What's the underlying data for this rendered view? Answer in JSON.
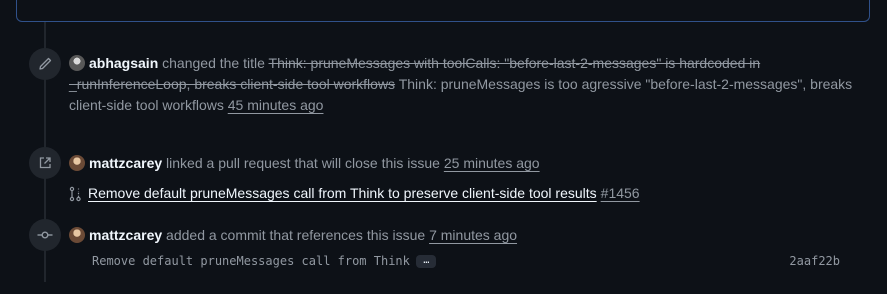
{
  "events": {
    "rename": {
      "actor": "abhagsain",
      "action": "changed the title",
      "old_title": "Think: pruneMessages with toolCalls: \"before-last-2-messages\" is hardcoded in _runInferenceLoop, breaks client-side tool workflows",
      "new_title": "Think: pruneMessages is too agressive \"before-last-2-messages\", breaks client-side tool workflows",
      "time": "45 minutes ago"
    },
    "linked_pr": {
      "actor": "mattzcarey",
      "action": "linked a pull request that will close this issue",
      "time": "25 minutes ago",
      "pr_title": "Remove default pruneMessages call from Think to preserve client-side tool results",
      "pr_number": "#1456"
    },
    "commit": {
      "actor": "mattzcarey",
      "action": "added a commit that references this issue",
      "time": "7 minutes ago",
      "message": "Remove default pruneMessages call from Think",
      "ellipsis": "…",
      "sha": "2aaf22b"
    }
  },
  "icons": {
    "rename": "pencil-icon",
    "cross_reference": "external-link-icon",
    "pr": "git-pull-request-icon",
    "commit": "git-commit-icon"
  },
  "colors": {
    "background": "#0d1117",
    "text_primary": "#f0f6fc",
    "text_muted": "#9198a1",
    "badge": "#21262d",
    "focus_border": "#30518a"
  }
}
